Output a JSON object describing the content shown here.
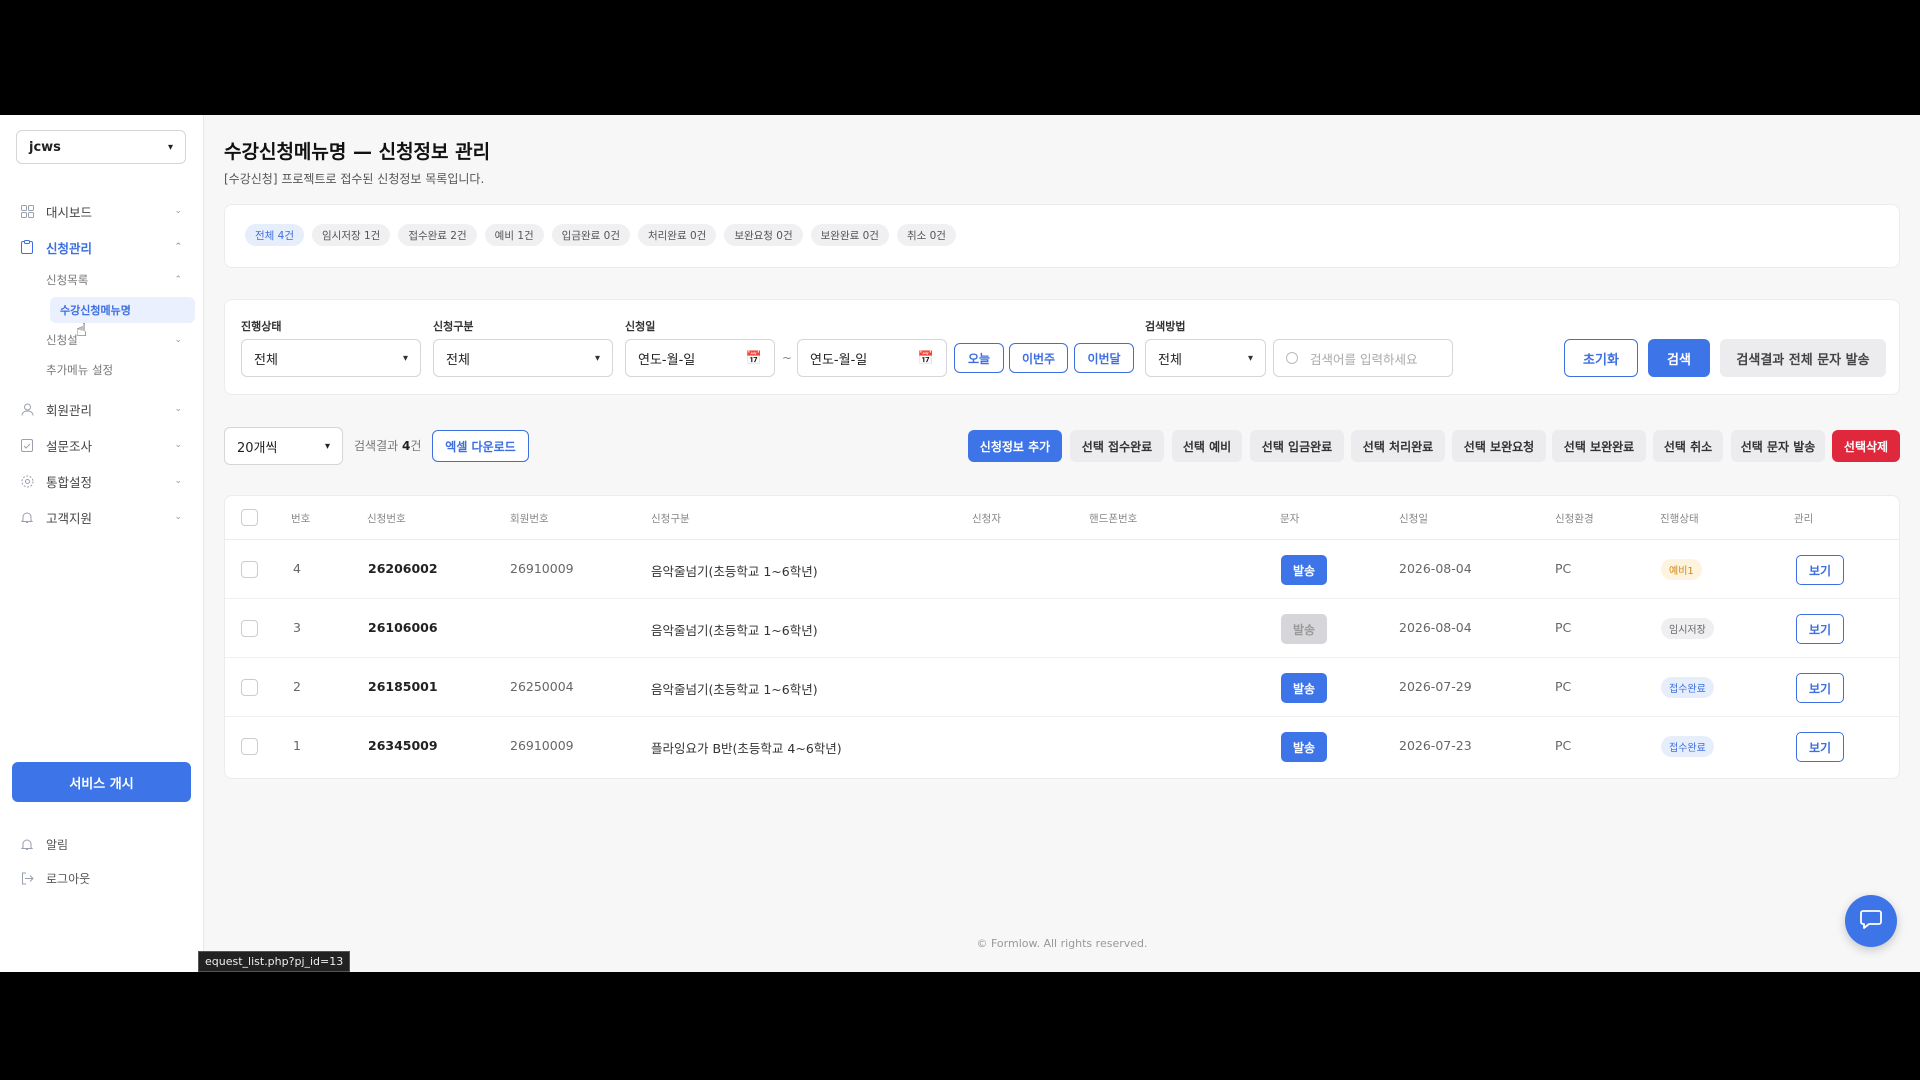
{
  "project_select": {
    "value": "jcws"
  },
  "sidebar": {
    "items": [
      {
        "label": "대시보드",
        "icon": "dashboard-icon"
      },
      {
        "label": "신청관리",
        "icon": "clipboard-icon"
      },
      {
        "label": "회원관리",
        "icon": "user-icon"
      },
      {
        "label": "설문조사",
        "icon": "survey-icon"
      },
      {
        "label": "통합설정",
        "icon": "gear-icon"
      },
      {
        "label": "고객지원",
        "icon": "bell-icon"
      }
    ],
    "sub_items": [
      {
        "label": "신청목록"
      },
      {
        "label": "수강신청메뉴명"
      },
      {
        "label": "신청설"
      },
      {
        "label": "추가메뉴 설정"
      }
    ],
    "service_button": "서비스 개시",
    "bottom_items": [
      {
        "label": "알림"
      },
      {
        "label": "로그아웃"
      }
    ]
  },
  "status_tooltip": "equest_list.php?pj_id=13",
  "header": {
    "title": "수강신청메뉴명 — 신청정보 관리",
    "subtitle": "[수강신청] 프로젝트로 접수된 신청정보 목록입니다."
  },
  "status_chips": [
    "전체 4건",
    "임시저장 1건",
    "접수완료 2건",
    "예비 1건",
    "입금완료 0건",
    "처리완료 0건",
    "보완요청 0건",
    "보완완료 0건",
    "취소 0건"
  ],
  "filters": {
    "status_label": "진행상태",
    "status_value": "전체",
    "type_label": "신청구분",
    "type_value": "전체",
    "date_label": "신청일",
    "date_placeholder": "연도-월-일",
    "date_tilde": "~",
    "quick_today": "오늘",
    "quick_week": "이번주",
    "quick_month": "이번달",
    "method_label": "검색방법",
    "method_value": "전체",
    "search_placeholder": "검색어를 입력하세요",
    "reset_button": "초기화",
    "search_button": "검색",
    "sms_all_button": "검색결과 전체 문자 발송"
  },
  "toolbar": {
    "per_page": "20개씩",
    "result_prefix": "검색결과",
    "result_count": "4",
    "result_suffix": "건",
    "excel_button": "엑셀 다운로드",
    "add_button": "신청정보 추가",
    "actions": [
      "선택 접수완료",
      "선택 예비",
      "선택 입금완료",
      "선택 처리완료",
      "선택 보완요청",
      "선택 보완완료",
      "선택 취소",
      "선택 문자 발송"
    ],
    "delete_button": "선택삭제"
  },
  "table": {
    "headers": {
      "no": "번호",
      "app_no": "신청번호",
      "member_no": "회원번호",
      "type": "신청구분",
      "applicant": "신청자",
      "phone": "핸드폰번호",
      "sms": "문자",
      "date": "신청일",
      "env": "신청환경",
      "status": "진행상태",
      "manage": "관리"
    },
    "rows": [
      {
        "no": "4",
        "app_no": "26206002",
        "member_no": "26910009",
        "type": "음악줄넘기(초등학교 1~6학년)",
        "sms": "발송",
        "date": "2026-08-04",
        "env": "PC",
        "status": "예비1",
        "view": "보기"
      },
      {
        "no": "3",
        "app_no": "26106006",
        "member_no": "",
        "type": "음악줄넘기(초등학교 1~6학년)",
        "sms": "발송",
        "date": "2026-08-04",
        "env": "PC",
        "status": "임시저장",
        "view": "보기"
      },
      {
        "no": "2",
        "app_no": "26185001",
        "member_no": "26250004",
        "type": "음악줄넘기(초등학교 1~6학년)",
        "sms": "발송",
        "date": "2026-07-29",
        "env": "PC",
        "status": "접수완료",
        "view": "보기"
      },
      {
        "no": "1",
        "app_no": "26345009",
        "member_no": "26910009",
        "type": "플라잉요가 B반(초등학교 4~6학년)",
        "sms": "발송",
        "date": "2026-07-23",
        "env": "PC",
        "status": "접수완료",
        "view": "보기"
      }
    ]
  },
  "footer": "© Formlow. All rights reserved.",
  "colors": {
    "accent": "#3d74e8",
    "danger": "#e0283c",
    "warning": "#d08a10"
  }
}
